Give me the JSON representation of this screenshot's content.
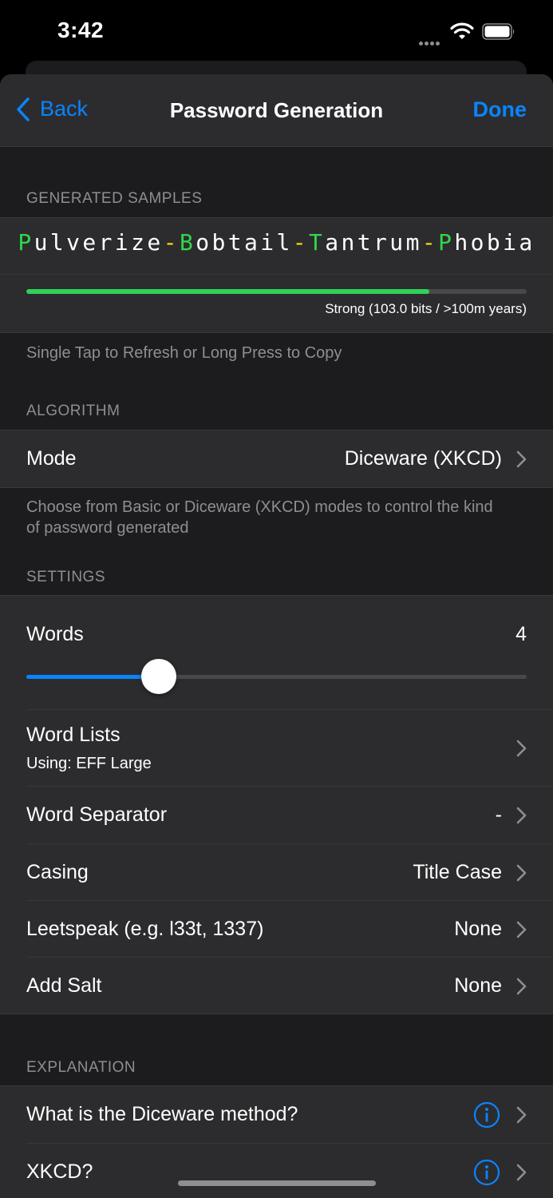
{
  "status_bar": {
    "time": "3:42"
  },
  "nav": {
    "back_label": "Back",
    "title": "Password Generation",
    "done_label": "Done"
  },
  "samples": {
    "header": "GENERATED SAMPLES",
    "password_parts": [
      {
        "text": "P",
        "kind": "upper"
      },
      {
        "text": "ulverize",
        "kind": "lower"
      },
      {
        "text": "-",
        "kind": "sep"
      },
      {
        "text": "B",
        "kind": "upper"
      },
      {
        "text": "obtail",
        "kind": "lower"
      },
      {
        "text": "-",
        "kind": "sep"
      },
      {
        "text": "T",
        "kind": "upper"
      },
      {
        "text": "antrum",
        "kind": "lower"
      },
      {
        "text": "-",
        "kind": "sep"
      },
      {
        "text": "P",
        "kind": "upper"
      },
      {
        "text": "hobia",
        "kind": "lower"
      }
    ],
    "strength_fraction": 0.805,
    "strength_text": "Strong (103.0 bits / >100m years)",
    "footer": "Single Tap to Refresh or Long Press to Copy"
  },
  "algorithm": {
    "header": "ALGORITHM",
    "mode_label": "Mode",
    "mode_value": "Diceware (XKCD)",
    "footer": "Choose from Basic or Diceware (XKCD) modes to control the kind of password generated"
  },
  "settings": {
    "header": "SETTINGS",
    "words_label": "Words",
    "words_value": "4",
    "words_slider_fraction": 0.265,
    "word_lists_label": "Word Lists",
    "word_lists_sub": "Using: EFF Large",
    "word_separator_label": "Word Separator",
    "word_separator_value": "-",
    "casing_label": "Casing",
    "casing_value": "Title Case",
    "leetspeak_label": "Leetspeak (e.g. l33t, 1337)",
    "leetspeak_value": "None",
    "salt_label": "Add Salt",
    "salt_value": "None"
  },
  "explanation": {
    "header": "EXPLANATION",
    "diceware_label": "What is the Diceware method?",
    "xkcd_label": "XKCD?"
  },
  "colors": {
    "accent": "#0a84ff",
    "password_upper": "#32d74b",
    "password_separator": "#ffd60a",
    "strength_bar": "#30d158"
  }
}
